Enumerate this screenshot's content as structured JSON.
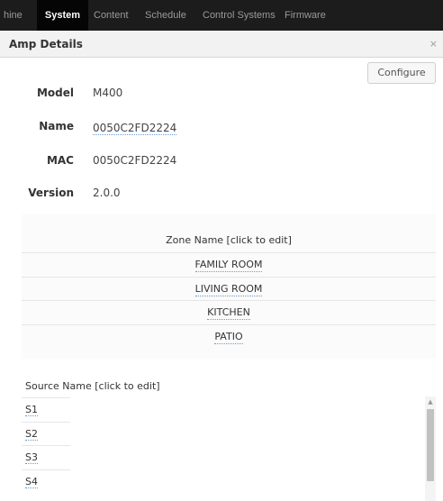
{
  "topnav": {
    "tabs": [
      "hine",
      "System",
      "Content",
      "Schedule",
      "Control Systems",
      "Firmware"
    ],
    "active_tab": "System"
  },
  "dialog": {
    "title": "Amp Details",
    "close_glyph": "×",
    "configure_label": "Configure"
  },
  "details": {
    "model_label": "Model",
    "model_value": "M400",
    "name_label": "Name",
    "name_value": "0050C2FD2224",
    "mac_label": "MAC",
    "mac_value": "0050C2FD2224",
    "version_label": "Version",
    "version_value": "2.0.0"
  },
  "zones": {
    "header": "Zone Name [click to edit]",
    "items": [
      "FAMILY ROOM",
      "LIVING ROOM",
      "KITCHEN",
      "PATIO"
    ]
  },
  "sources": {
    "header": "Source Name [click to edit]",
    "items": [
      "S1",
      "S2",
      "S3",
      "S4"
    ]
  },
  "icons": {
    "close": "close-icon",
    "scroll_up": "scroll-up-arrow-icon"
  }
}
